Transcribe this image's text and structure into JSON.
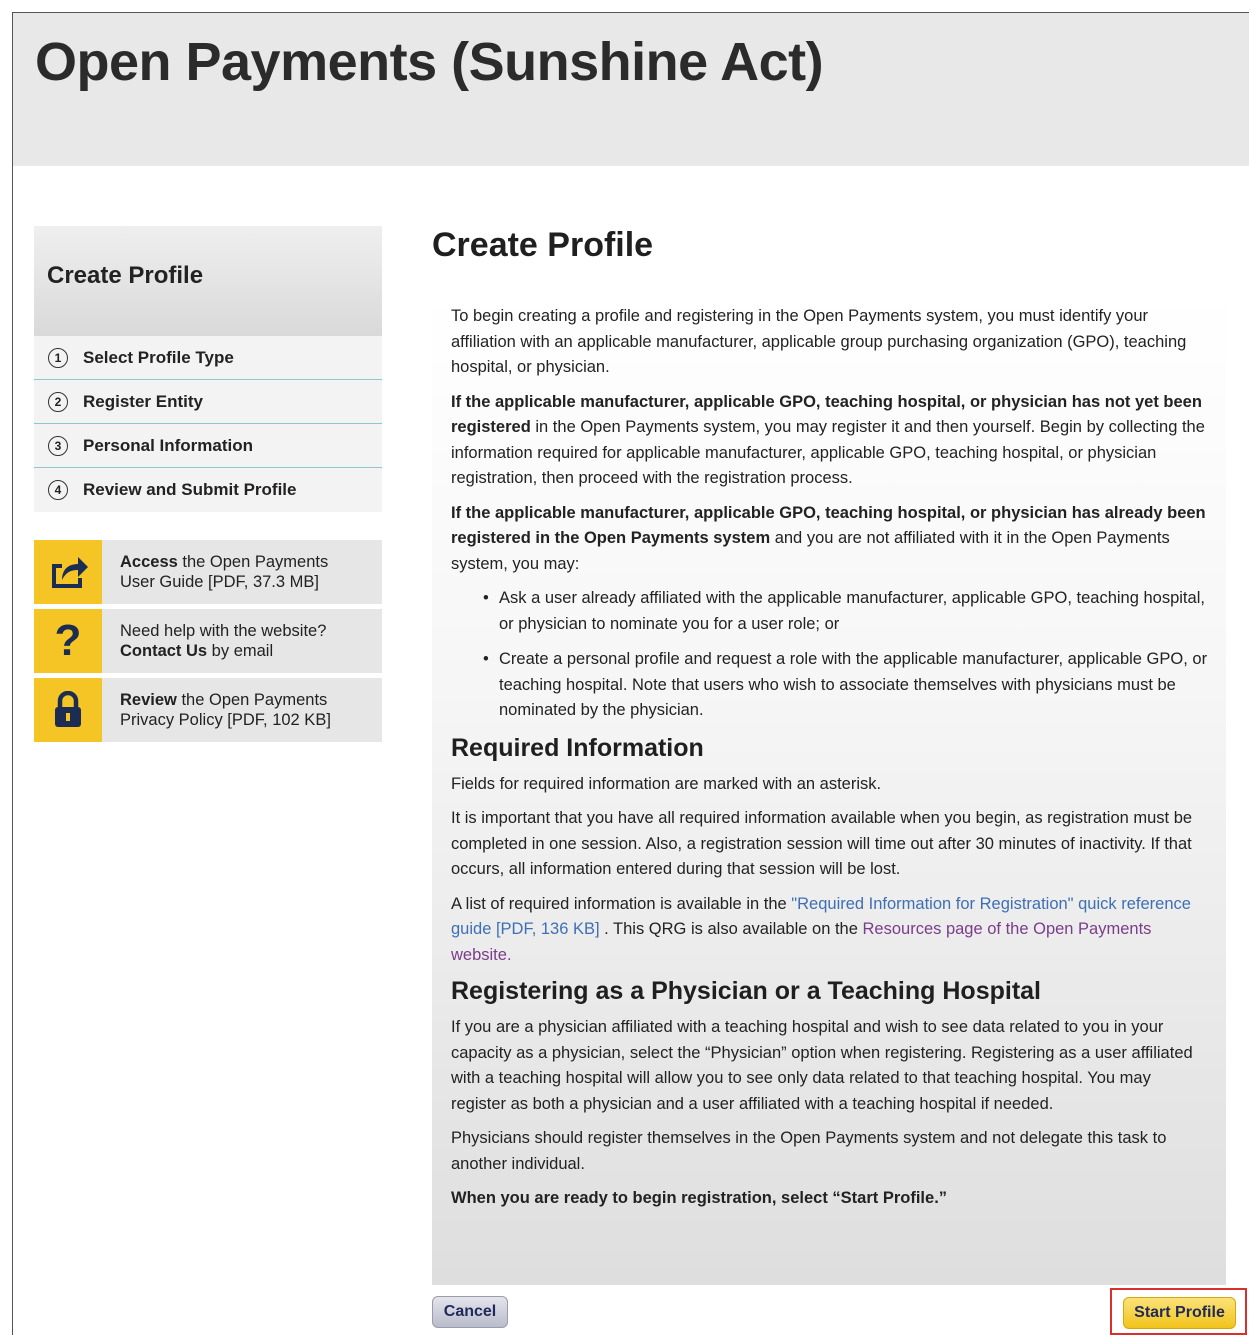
{
  "app": {
    "title": "Open Payments (Sunshine Act)"
  },
  "sidebar": {
    "title": "Create Profile",
    "steps": [
      {
        "num": "1",
        "label": "Select Profile Type"
      },
      {
        "num": "2",
        "label": "Register Entity"
      },
      {
        "num": "3",
        "label": "Personal Information"
      },
      {
        "num": "4",
        "label": "Review and Submit Profile"
      }
    ],
    "help": [
      {
        "icon": "share-icon",
        "bold": "Access",
        "line1_rest": " the Open Payments",
        "line2": "User Guide [PDF, 37.3 MB]"
      },
      {
        "icon": "question-icon",
        "line1": "Need help with the website?",
        "bold": "Contact Us",
        "line2_rest": " by email"
      },
      {
        "icon": "lock-icon",
        "bold": "Review",
        "line1_rest": " the Open Payments",
        "line2": "Privacy Policy [PDF, 102 KB]"
      }
    ]
  },
  "main": {
    "title": "Create Profile",
    "intro": "To begin creating a profile and registering in the Open Payments system, you must identify your affiliation with an applicable manufacturer, applicable group purchasing organization (GPO), teaching hospital, or physician.",
    "para2_bold": "If the applicable manufacturer, applicable GPO, teaching hospital, or physician has not yet been registered",
    "para2_rest": " in the Open Payments system, you may register it and then yourself. Begin by collecting the information required for applicable manufacturer, applicable GPO, teaching hospital, or physician registration, then proceed with the registration process.",
    "para3_bold": "If the applicable manufacturer, applicable GPO, teaching hospital, or physician has already been registered in the Open Payments system",
    "para3_rest": " and you are not affiliated with it in the Open Payments system, you may:",
    "bullets": [
      "Ask a user already affiliated with the applicable manufacturer, applicable GPO, teaching hospital, or physician to nominate you for a user role; or",
      "Create a personal profile and request a role with the applicable manufacturer, applicable GPO, or teaching hospital. Note that users who wish to associate themselves with physicians must be nominated by the physician."
    ],
    "required_heading": "Required Information",
    "required_p1": "Fields for required information are marked with an asterisk.",
    "required_p2": "It is important that you have all required information available when you begin, as registration must be completed in one session. Also, a registration session will time out after 30 minutes of inactivity. If that occurs, all information entered during that session will be lost.",
    "required_p3_pre": "A list of required information is available in the ",
    "required_p3_link1": "\"Required Information for Registration\" quick reference guide [PDF, 136 KB]",
    "required_p3_mid": " . This QRG is also available on the ",
    "required_p3_link2": "Resources page of the Open Payments website.",
    "physician_heading": "Registering as a Physician or a Teaching Hospital",
    "physician_p1": "If you are a physician affiliated with a teaching hospital and wish to see data related to you in your capacity as a physician, select the “Physician” option when registering. Registering as a user affiliated with a teaching hospital will allow you to see only data related to that teaching hospital. You may register as both a physician and a user affiliated with a teaching hospital if needed.",
    "physician_p2": "Physicians should register themselves in the Open Payments system and not delegate this task to another individual.",
    "final_bold": "When you are ready to begin registration, select “Start Profile.”"
  },
  "buttons": {
    "cancel": "Cancel",
    "start": "Start Profile"
  },
  "colors": {
    "header_bg": "#e8e8e8",
    "accent_yellow": "#f4c525",
    "highlight_red": "#d9302c",
    "link_blue": "#3e6fb5"
  }
}
